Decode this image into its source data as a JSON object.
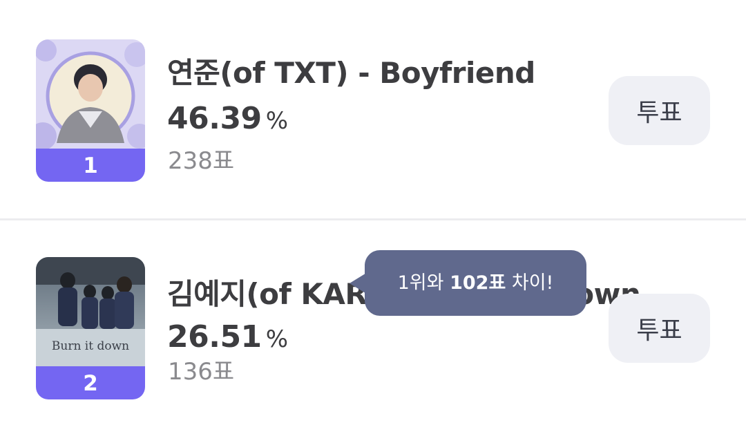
{
  "colors": {
    "rank_badge": "#7466f2",
    "vote_button_bg": "#eff0f5",
    "tooltip_bg": "#60698d",
    "divider": "#ececef"
  },
  "entries": [
    {
      "rank": "1",
      "title": "연준(of TXT) - Boyfriend",
      "percent": "46.39",
      "percent_unit": "%",
      "votes": "238표",
      "vote_button_label": "투표"
    },
    {
      "rank": "2",
      "title": "김예지(of KARD) - Burn it down",
      "percent": "26.51",
      "percent_unit": "%",
      "votes": "136표",
      "vote_button_label": "투표"
    }
  ],
  "tooltip": {
    "prefix": "1위와 ",
    "highlight": "102표",
    "suffix": " 차이!"
  }
}
